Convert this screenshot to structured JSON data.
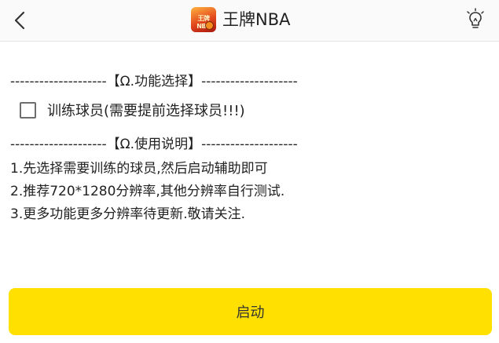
{
  "app_bar": {
    "title": "王牌NBA",
    "logo_text": "王牌NBA",
    "back_icon": "chevron-left-icon",
    "tip_icon": "lightbulb-icon"
  },
  "sections": {
    "function_header": "--------------------【Ω.功能选择】--------------------",
    "usage_header": "--------------------【Ω.使用说明】--------------------"
  },
  "options": [
    {
      "label": "训练球员(需要提前选择球员!!!)",
      "checked": false
    }
  ],
  "instructions": [
    "1.先选择需要训练的球员,然后启动辅助即可",
    "2.推荐720*1280分辨率,其他分辨率自行测试.",
    "3.更多功能更多分辨率待更新.敬请关注."
  ],
  "start_button": {
    "label": "启动"
  },
  "colors": {
    "accent": "#ffe000",
    "app_bar_bg": "#fafafa"
  }
}
